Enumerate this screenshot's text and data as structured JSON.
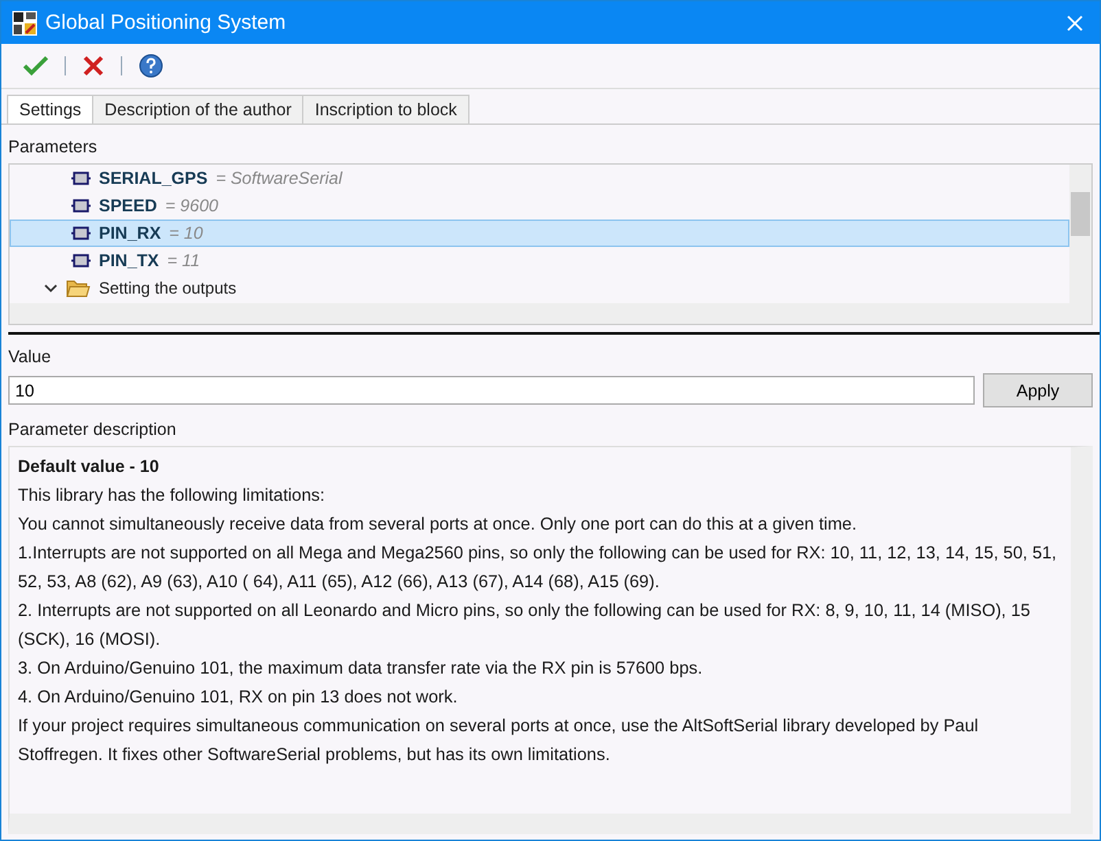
{
  "window": {
    "title": "Global Positioning System"
  },
  "tabs": [
    {
      "label": "Settings",
      "selected": true
    },
    {
      "label": "Description of the author",
      "selected": false
    },
    {
      "label": "Inscription to block",
      "selected": false
    }
  ],
  "parameters": {
    "label": "Parameters",
    "items": [
      {
        "kind": "param",
        "name": "SERIAL_GPS",
        "value": "= SoftwareSerial",
        "selected": false
      },
      {
        "kind": "param",
        "name": "SPEED",
        "value": "= 9600",
        "selected": false
      },
      {
        "kind": "param",
        "name": "PIN_RX",
        "value": "= 10",
        "selected": true
      },
      {
        "kind": "param",
        "name": "PIN_TX",
        "value": "= 11",
        "selected": false
      },
      {
        "kind": "folder",
        "name": "Setting the outputs",
        "expanded": true,
        "selected": false
      }
    ]
  },
  "value": {
    "label": "Value",
    "text": "10",
    "button": "Apply"
  },
  "description": {
    "label": "Parameter description",
    "heading": "Default value - 10",
    "paragraphs": [
      "This library has the following limitations:",
      "You cannot simultaneously receive data from several ports at once. Only one port can do this at a given time.",
      "1.Interrupts are not supported on all Mega and Mega2560 pins, so only the following can be used for RX: 10, 11, 12, 13, 14, 15, 50, 51, 52, 53, A8 (62), A9 (63), A10 ( 64), A11 (65), A12 (66), A13 (67), A14 (68), A15 (69).",
      "2. Interrupts are not supported on all Leonardo and Micro pins, so only the following can be used for RX: 8, 9, 10, 11, 14 (MISO), 15 (SCK), 16 (MOSI).",
      "3. On Arduino/Genuino 101, the maximum data transfer rate via the RX pin is 57600 bps.",
      "4. On Arduino/Genuino 101, RX on pin 13 does not work.",
      "If your project requires simultaneous communication on several ports at once, use the AltSoftSerial library developed by Paul Stoffregen. It fixes other SoftwareSerial problems, but has its own limitations."
    ]
  }
}
